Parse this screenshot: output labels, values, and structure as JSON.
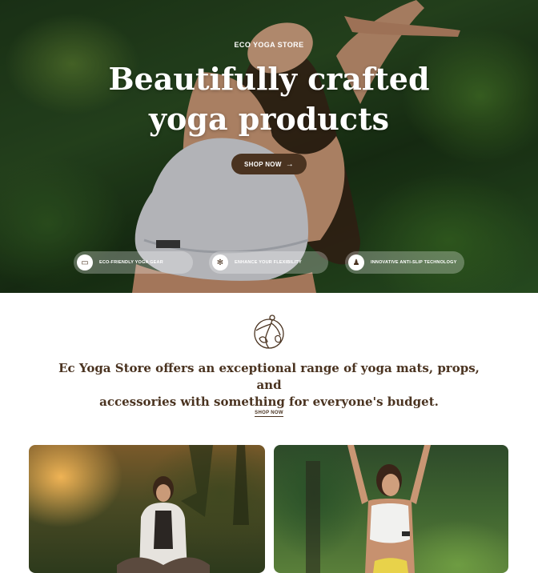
{
  "hero": {
    "eyebrow": "ECO YOGA STORE",
    "title_line1": "Beautifully crafted",
    "title_line2": "yoga products",
    "cta_label": "SHOP NOW",
    "cta_arrow": "→"
  },
  "features": [
    {
      "icon": "mat-icon",
      "glyph": "▭",
      "label": "ECO-FRIENDLY YOGA GEAR"
    },
    {
      "icon": "lotus-icon",
      "glyph": "✻",
      "label": "ENHANCE YOUR FLEXIBILITY"
    },
    {
      "icon": "anti-slip-icon",
      "glyph": "♟",
      "label": "INNOVATIVE ANTI-SLIP TECHNOLOGY"
    }
  ],
  "intro": {
    "text_line1": "Ec Yoga Store offers an exceptional range of yoga mats, props, and",
    "text_line2": "accessories with something for everyone's budget.",
    "link_label": "SHOP NOW"
  },
  "colors": {
    "brand_brown": "#4a3320",
    "white": "#ffffff"
  }
}
